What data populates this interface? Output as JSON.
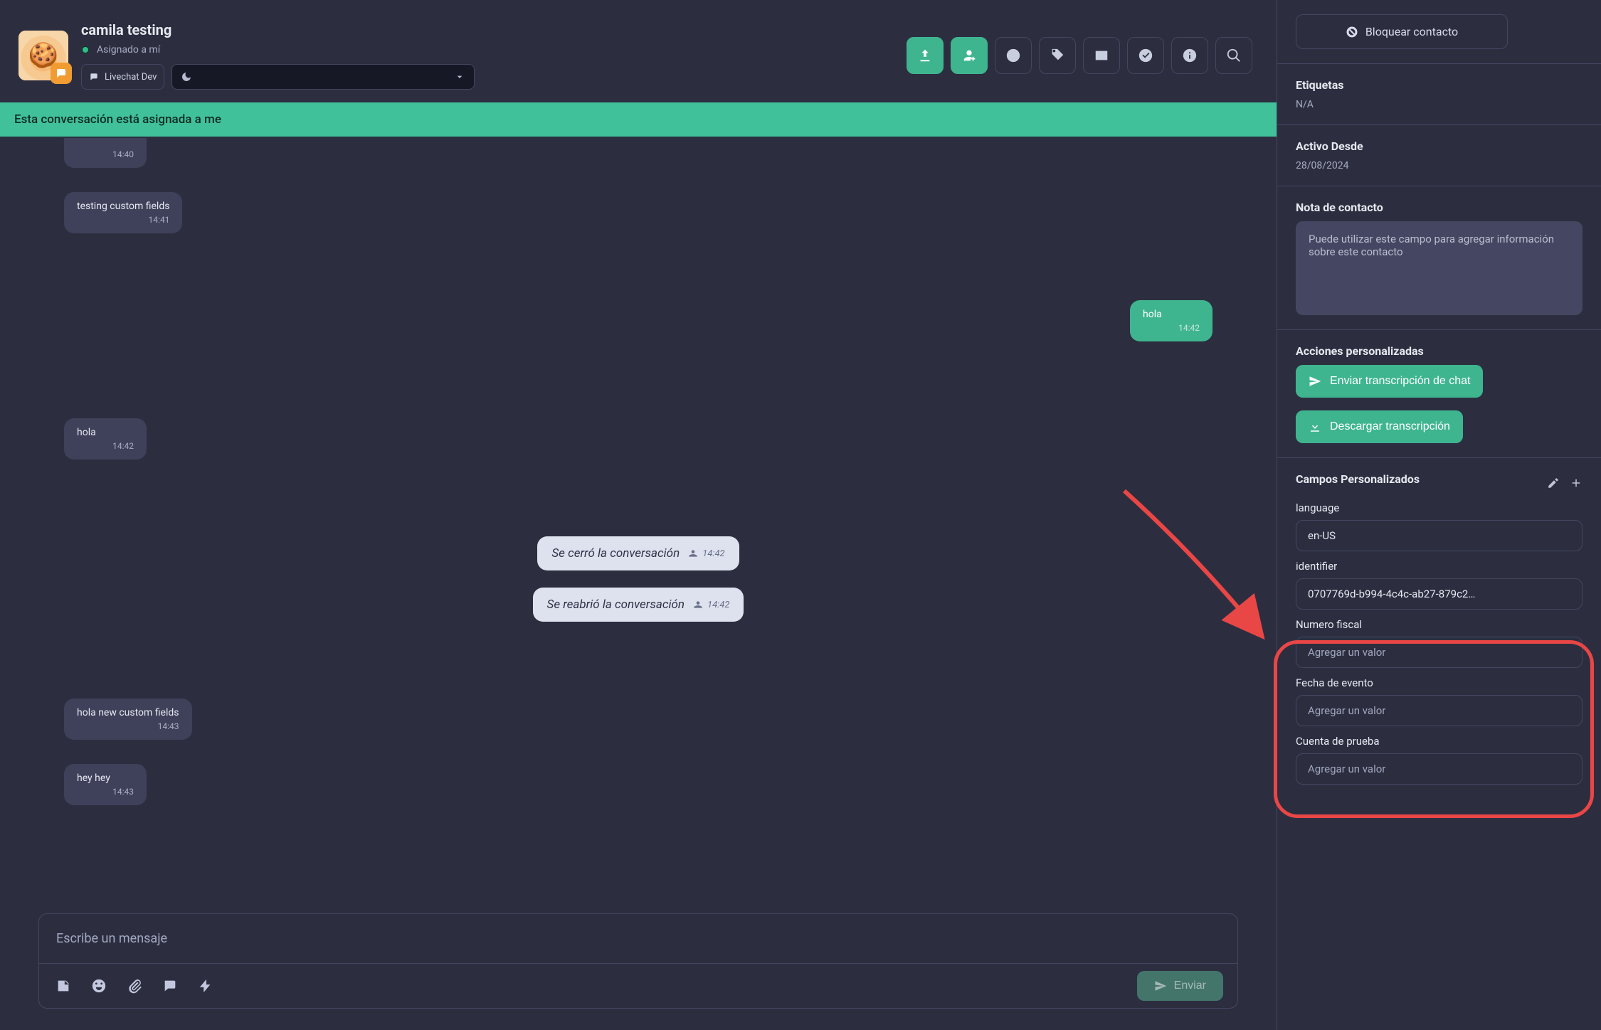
{
  "header": {
    "contact_name": "camila testing",
    "status": "Asignado a mí",
    "badge": "Livechat Dev"
  },
  "banner": "Esta conversación está asignada a me",
  "messages": [
    {
      "side": "left",
      "type": "in_truncated",
      "text": "",
      "time": "14:40"
    },
    {
      "side": "left",
      "type": "in",
      "text": "testing custom fields",
      "time": "14:41"
    },
    {
      "side": "right",
      "type": "out",
      "text": "hola",
      "time": "14:42"
    },
    {
      "side": "left",
      "type": "in",
      "text": "hola",
      "time": "14:42"
    },
    {
      "side": "center",
      "type": "sys",
      "text": "Se cerró la conversación",
      "time": "14:42"
    },
    {
      "side": "center",
      "type": "sys",
      "text": "Se reabrió la conversación",
      "time": "14:42"
    },
    {
      "side": "left",
      "type": "in",
      "text": "hola new custom fields",
      "time": "14:43"
    },
    {
      "side": "left",
      "type": "in",
      "text": "hey hey",
      "time": "14:43"
    }
  ],
  "compose": {
    "placeholder": "Escribe un mensaje",
    "send": "Enviar"
  },
  "sidebar": {
    "block_contact": "Bloquear contacto",
    "etiquetas": {
      "title": "Etiquetas",
      "value": "N/A"
    },
    "activo": {
      "title": "Activo Desde",
      "value": "28/08/2024"
    },
    "nota": {
      "title": "Nota de contacto",
      "placeholder": "Puede utilizar este campo para agregar información sobre este contacto"
    },
    "acciones": {
      "title": "Acciones personalizadas",
      "send_transcript": "Enviar transcripción de chat",
      "download_transcript": "Descargar transcripción"
    },
    "custom_fields": {
      "title": "Campos Personalizados",
      "fields": [
        {
          "label": "language",
          "value": "en-US",
          "placeholder": ""
        },
        {
          "label": "identifier",
          "value": "0707769d-b994-4c4c-ab27-879c2…",
          "placeholder": ""
        },
        {
          "label": "Numero fiscal",
          "value": "",
          "placeholder": "Agregar un valor"
        },
        {
          "label": "Fecha de evento",
          "value": "",
          "placeholder": "Agregar un valor"
        },
        {
          "label": "Cuenta de prueba",
          "value": "",
          "placeholder": "Agregar un valor"
        }
      ]
    }
  }
}
